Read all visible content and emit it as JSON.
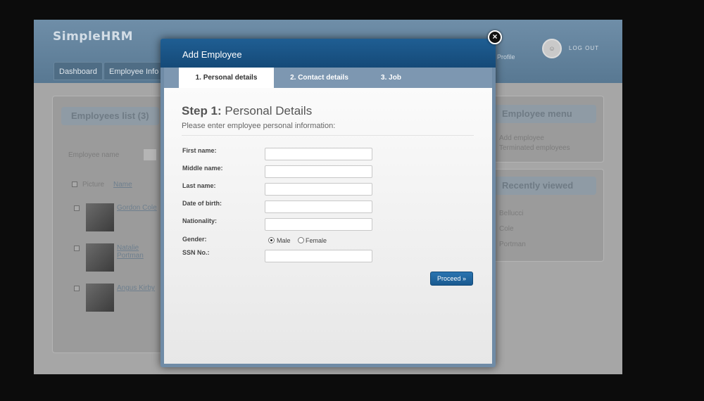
{
  "app": {
    "logo": "SimpleHRM",
    "nav": [
      "Dashboard",
      "Employee Info"
    ],
    "profile": "Profile",
    "logout": "LOG OUT",
    "employees_panel": {
      "title": "Employees list (3)",
      "filter_label": "Employee name",
      "columns": [
        "Picture",
        "Name"
      ],
      "rows": [
        "Gordon Cole",
        "Natalie Portman",
        "Angus Kirby"
      ]
    },
    "employee_menu": {
      "title": "Employee menu",
      "items": [
        "Add employee",
        "Terminated employees"
      ]
    },
    "recently_viewed": {
      "title": "Recently viewed",
      "items": [
        "Bellucci",
        "Cole",
        "Portman"
      ]
    }
  },
  "modal": {
    "title": "Add Employee",
    "close_symbol": "×",
    "tabs": [
      "1. Personal details",
      "2. Contact details",
      "3. Job"
    ],
    "step_prefix": "Step 1:",
    "step_title": "Personal Details",
    "step_subtitle": "Please enter employee personal information:",
    "fields": {
      "first_name": "First name:",
      "middle_name": "Middle name:",
      "last_name": "Last name:",
      "date_of_birth": "Date of birth:",
      "nationality": "Nationality:",
      "gender": "Gender:",
      "ssn": "SSN No.:"
    },
    "gender_options": [
      "Male",
      "Female"
    ],
    "gender_selected": "Male",
    "proceed_label": "Proceed »"
  }
}
